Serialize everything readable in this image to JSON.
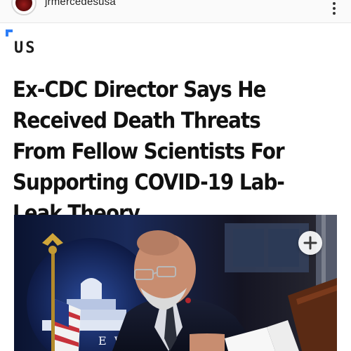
{
  "header": {
    "username": "jrmercedesusa"
  },
  "article": {
    "category": "US",
    "headline": "Ex-CDC Director Says He Received Death Threats From Fellow Scientists For Supporting COVID-19 Lab-Leak Theory"
  },
  "photo": {
    "backdrop_text": "E WHI"
  },
  "icons": {
    "more": "more-vertical-icon",
    "add": "plus-circle-icon"
  },
  "colors": {
    "accent": "#2d7ef7",
    "headline": "#111111"
  }
}
